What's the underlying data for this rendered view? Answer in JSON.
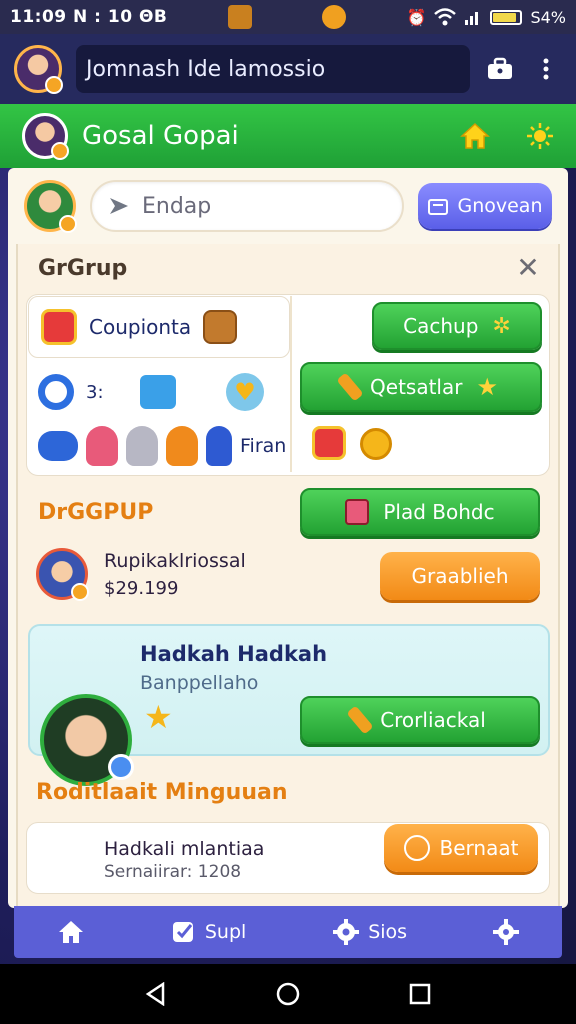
{
  "status_bar": {
    "time": "11:09 N : 10 ΘΒ",
    "battery": "S4%",
    "battery_level": 0.8
  },
  "top_bar": {
    "title": "Jomnash Ide lamossio"
  },
  "header": {
    "title": "Gosal Gopai"
  },
  "search": {
    "placeholder": "Endap",
    "button_label": "Gnovean"
  },
  "group": {
    "title": "GrGrup",
    "coupon_label": "Coupionta",
    "counter": "3:",
    "friend_label": "Firan",
    "buttons": {
      "cachup": "Cachup",
      "qetsatlar": "Qetsatlar"
    }
  },
  "drgroup": {
    "title": "DrGGPUP",
    "primary_button": "Plad Bohdc",
    "item_name": "Rupikaklriossal",
    "item_price": "$29.199",
    "item_button": "Graablieh"
  },
  "highlight": {
    "name": "Hadkah Hadkah",
    "subtitle": "Banppellaho",
    "button": "Crorliackal"
  },
  "featured": {
    "title": "Roditlaait Minguuan",
    "name": "Hadkali mlantiaa",
    "meta": "Sernaiirar: 1208",
    "button": "Bernaat"
  },
  "bottom_nav": {
    "supl": "Supl",
    "sios": "Sios"
  },
  "colors": {
    "green": "#23a233",
    "violet": "#5a5fe8",
    "orange": "#f28a16",
    "nav": "#5b5fd6"
  }
}
